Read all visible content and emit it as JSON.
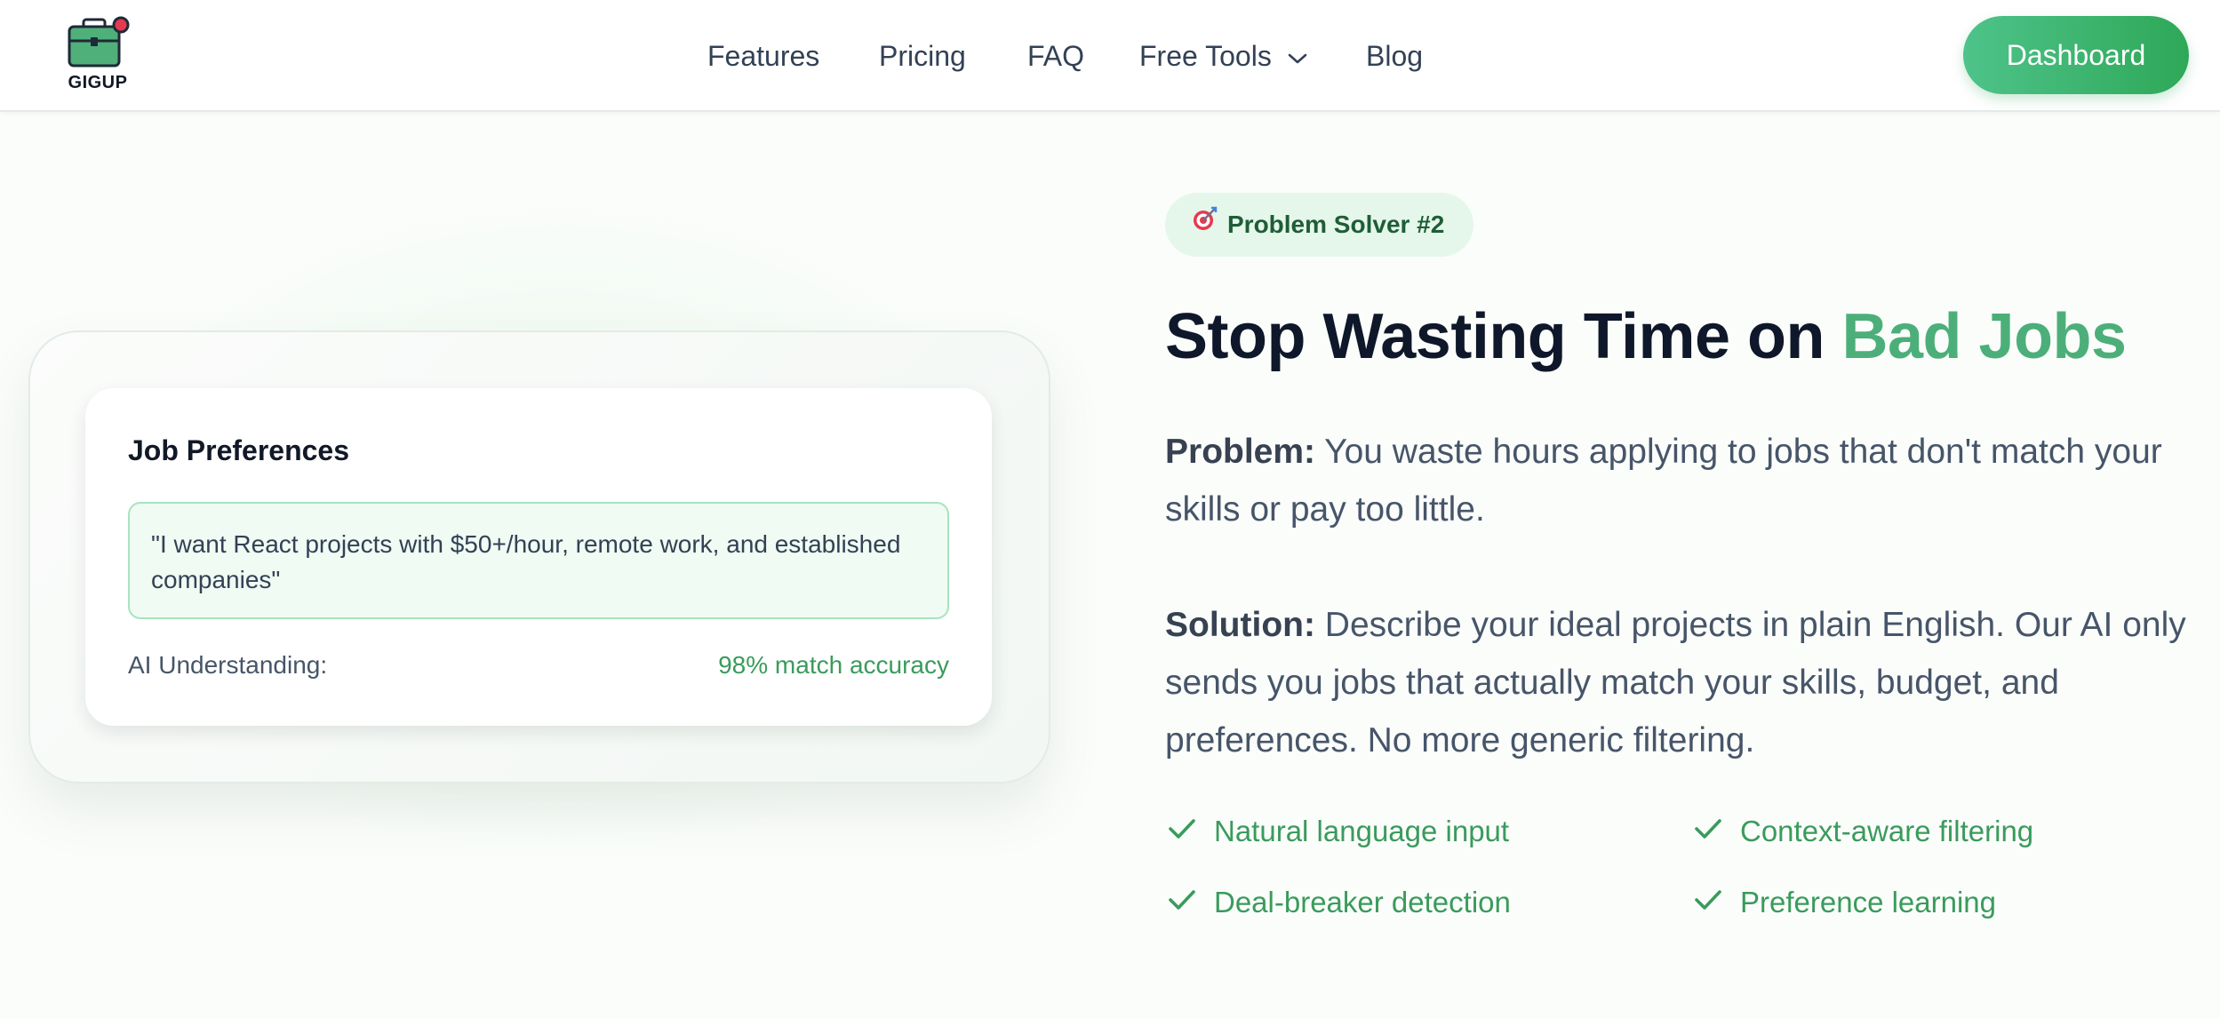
{
  "brand": {
    "name": "GIGUP",
    "logo_icon": "briefcase-icon"
  },
  "nav": {
    "items": [
      {
        "label": "Features"
      },
      {
        "label": "Pricing"
      },
      {
        "label": "FAQ"
      },
      {
        "label": "Free Tools",
        "icon": "chevron-down-icon"
      },
      {
        "label": "Blog"
      }
    ],
    "dashboard_label": "Dashboard"
  },
  "card": {
    "title": "Job Preferences",
    "quote": "\"I want React projects with $50+/hour, remote work, and established companies\"",
    "ai_label": "AI Understanding:",
    "ai_value": "98% match accuracy"
  },
  "section": {
    "badge_icon": "target-icon",
    "badge": "Problem Solver #2",
    "headline_main": "Stop Wasting Time on ",
    "headline_accent": "Bad Jobs",
    "problem_label": "Problem:",
    "problem_text": " You waste hours applying to jobs that don't match your skills or pay too little.",
    "solution_label": "Solution:",
    "solution_text": " Describe your ideal projects in plain English. Our AI only sends you jobs that actually match your skills, budget, and preferences. No more generic filtering.",
    "features": [
      "Natural language input",
      "Context-aware filtering",
      "Deal-breaker detection",
      "Preference learning"
    ]
  },
  "colors": {
    "accent_green": "#4caf7a",
    "button_green": "#2ea858",
    "badge_bg": "#e5f7ea",
    "heading_dark": "#0f172a"
  }
}
